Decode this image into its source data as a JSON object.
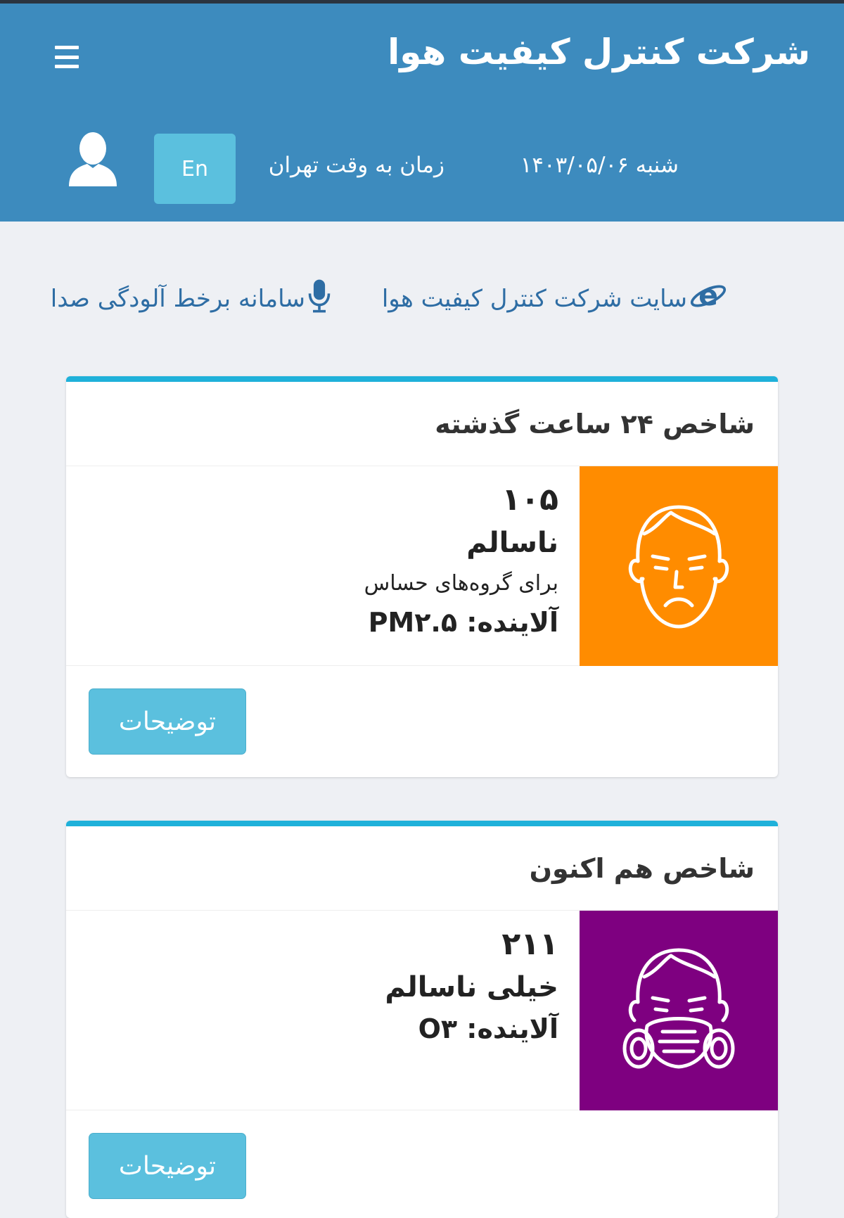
{
  "header": {
    "title": "شرکت کنترل کیفیت هوا",
    "lang_button": "En",
    "timezone": "زمان به وقت تهران",
    "date": "شنبه ۱۴۰۳/۰۵/۰۶"
  },
  "links": {
    "site": "سایت شرکت کنترل کیفیت هوا",
    "noise": "سامانه برخط آلودگی صدا"
  },
  "cards": [
    {
      "title": "شاخص ۲۴ ساعت گذشته",
      "aqi": "۱۰۵",
      "status": "ناسالم",
      "sub": "برای گروه‌های حساس",
      "pollutant": "آلاینده: PM۲.۵",
      "color": "#ff8c00",
      "icon": "sad-face-icon",
      "button": "توضیحات"
    },
    {
      "title": "شاخص هم اکنون",
      "aqi": "۲۱۱",
      "status": "خیلی ناسالم",
      "pollutant": "آلاینده: O۳",
      "color": "#7e0080",
      "icon": "gas-mask-face-icon",
      "button": "توضیحات"
    }
  ],
  "colors": {
    "header_bg": "#3d8bbe",
    "accent": "#1fb1da",
    "button_bg": "#5bc0de",
    "link": "#2e6da4"
  }
}
